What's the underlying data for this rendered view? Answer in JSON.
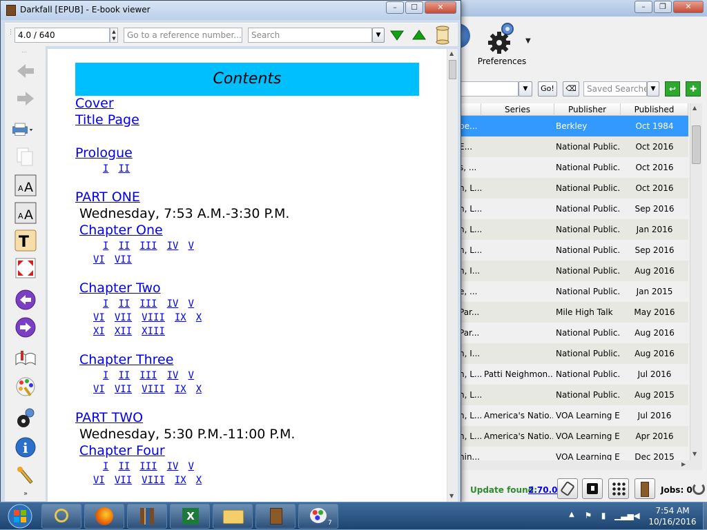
{
  "viewer": {
    "title": "Darkfall [EPUB] - E-book viewer",
    "position_value": "4.0 / 640",
    "reference_placeholder": "Go to a reference number...",
    "search_placeholder": "Search",
    "contents_heading": "Contents",
    "toc": {
      "cover": "Cover",
      "title_page": "Title Page",
      "prologue": "Prologue",
      "prologue_parts": [
        "I",
        "II"
      ],
      "part_one": "PART ONE",
      "part_one_time": "Wednesday, 7:53 A.M.-3:30 P.M.",
      "chapter_one": "Chapter One",
      "ch1_row1": [
        "I",
        "II",
        "III",
        "IV",
        "V"
      ],
      "ch1_row2": [
        "VI",
        "VII"
      ],
      "chapter_two": "Chapter Two",
      "ch2_row1": [
        "I",
        "II",
        "III",
        "IV",
        "V"
      ],
      "ch2_row2": [
        "VI",
        "VII",
        "VIII",
        "IX",
        "X"
      ],
      "ch2_row3": [
        "XI",
        "XII",
        "XIII"
      ],
      "chapter_three": "Chapter Three",
      "ch3_row1": [
        "I",
        "II",
        "III",
        "IV",
        "V"
      ],
      "ch3_row2": [
        "VI",
        "VII",
        "VIII",
        "IX",
        "X"
      ],
      "part_two": "PART TWO",
      "part_two_time": "Wednesday, 5:30 P.M.-11:00 P.M.",
      "chapter_four": "Chapter Four",
      "ch4_row1": [
        "I",
        "II",
        "III",
        "IV",
        "V"
      ],
      "ch4_row2": [
        "VI",
        "VII",
        "VIII",
        "IX",
        "X"
      ]
    }
  },
  "library": {
    "preferences_label": "Preferences",
    "go_label": "Go!",
    "saved_searches_placeholder": "Saved Searches",
    "columns": [
      "Series",
      "Publisher",
      "Published"
    ],
    "rows": [
      {
        "title": "pe...",
        "series": "",
        "publisher": "Berkley",
        "published": "Oct 1984"
      },
      {
        "title": "E...",
        "series": "",
        "publisher": "National Public...",
        "published": "Oct 2016"
      },
      {
        "title": "s, ...",
        "series": "",
        "publisher": "National Public...",
        "published": "Oct 2016"
      },
      {
        "title": "n, L...",
        "series": "",
        "publisher": "National Public...",
        "published": "Oct 2016"
      },
      {
        "title": "n, L...",
        "series": "",
        "publisher": "National Public...",
        "published": "Sep 2016"
      },
      {
        "title": "n, L...",
        "series": "",
        "publisher": "National Public...",
        "published": "Jan 2016"
      },
      {
        "title": "n, L...",
        "series": "",
        "publisher": "National Public...",
        "published": "Sep 2016"
      },
      {
        "title": "n, I...",
        "series": "",
        "publisher": "National Public...",
        "published": "Aug 2016"
      },
      {
        "title": "e, ...",
        "series": "",
        "publisher": "National Public...",
        "published": "Jan 2015"
      },
      {
        "title": "Par...",
        "series": "",
        "publisher": "Mile High Talk",
        "published": "May 2016"
      },
      {
        "title": "Par...",
        "series": "",
        "publisher": "National Public...",
        "published": "Aug 2016"
      },
      {
        "title": "n, I...",
        "series": "",
        "publisher": "National Public...",
        "published": "Aug 2016"
      },
      {
        "title": "n, L...",
        "series": "Patti Neighmon...",
        "publisher": "National Public...",
        "published": "Jul 2016"
      },
      {
        "title": "n, L...",
        "series": "",
        "publisher": "National Public...",
        "published": "Aug 2015"
      },
      {
        "title": "n, L...",
        "series": "America's Natio...",
        "publisher": "VOA Learning E...",
        "published": "Jul 2016"
      },
      {
        "title": "n, L...",
        "series": "America's Natio...",
        "publisher": "VOA Learning E...",
        "published": "Apr 2016"
      },
      {
        "title": "nin...",
        "series": "",
        "publisher": "VOA Learning E...",
        "published": "Dec 2015"
      }
    ],
    "update_label": "Update found:",
    "update_version": "2.70.0",
    "jobs_label": "Jobs: 0"
  },
  "taskbar": {
    "time": "7:54 AM",
    "date": "10/16/2016",
    "paint_badge": "7"
  },
  "colors": {
    "contents_bg": "#00bfff",
    "link": "#0000ee",
    "selected_row": "#3399ff",
    "update_green": "#2e8b2e"
  }
}
